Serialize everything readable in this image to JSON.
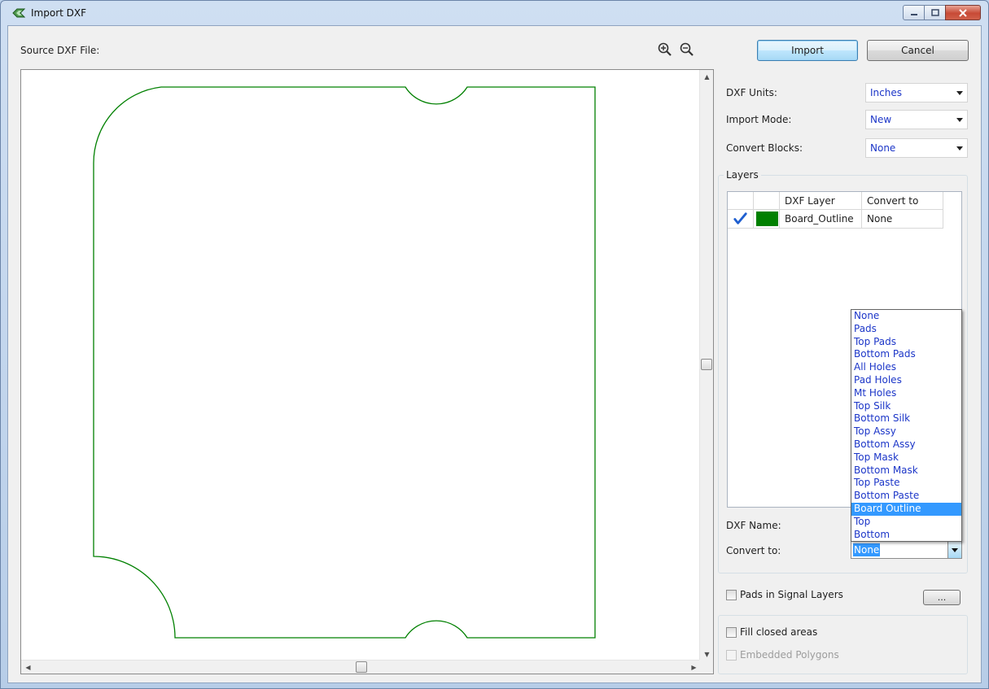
{
  "window": {
    "title": "Import DXF",
    "caption_icons": [
      "minimize-icon",
      "maximize-icon",
      "close-icon"
    ]
  },
  "left": {
    "source_label": "Source DXF File:",
    "icons": [
      "zoom-in-icon",
      "zoom-out-icon"
    ],
    "outline_color": "#008000"
  },
  "buttons": {
    "import": "Import",
    "cancel": "Cancel",
    "more": "..."
  },
  "settings": {
    "dxf_units": {
      "label": "DXF Units:",
      "value": "Inches"
    },
    "import_mode": {
      "label": "Import Mode:",
      "value": "New"
    },
    "convert_blocks": {
      "label": "Convert Blocks:",
      "value": "None"
    }
  },
  "layers": {
    "group_title": "Layers",
    "columns": [
      "",
      "",
      "DXF Layer",
      "Convert to"
    ],
    "rows": [
      {
        "checked": true,
        "color": "#008000",
        "dxf_layer": "Board_Outline",
        "convert_to": "None"
      }
    ],
    "dxf_name_label": "DXF Name:",
    "convert_to_label": "Convert to:",
    "convert_to_value": "None",
    "dropdown_options": [
      "None",
      "Pads",
      "Top Pads",
      "Bottom Pads",
      "All Holes",
      "Pad Holes",
      "Mt Holes",
      "Top Silk",
      "Bottom Silk",
      "Top Assy",
      "Bottom Assy",
      "Top Mask",
      "Bottom Mask",
      "Top Paste",
      "Bottom Paste",
      "Board Outline",
      "Top",
      "Bottom"
    ],
    "dropdown_highlighted": "Board Outline"
  },
  "options": {
    "pads_in_signal_layers": {
      "label": "Pads in Signal Layers",
      "checked": false
    },
    "fill_closed_areas": {
      "label": "Fill closed areas",
      "checked": false
    },
    "embedded_polygons": {
      "label": "Embedded Polygons",
      "checked": false,
      "enabled": false
    }
  },
  "colors": {
    "accent_text": "#1c36c8",
    "selection": "#3399ff",
    "checkmark": "#1f5fd0"
  }
}
